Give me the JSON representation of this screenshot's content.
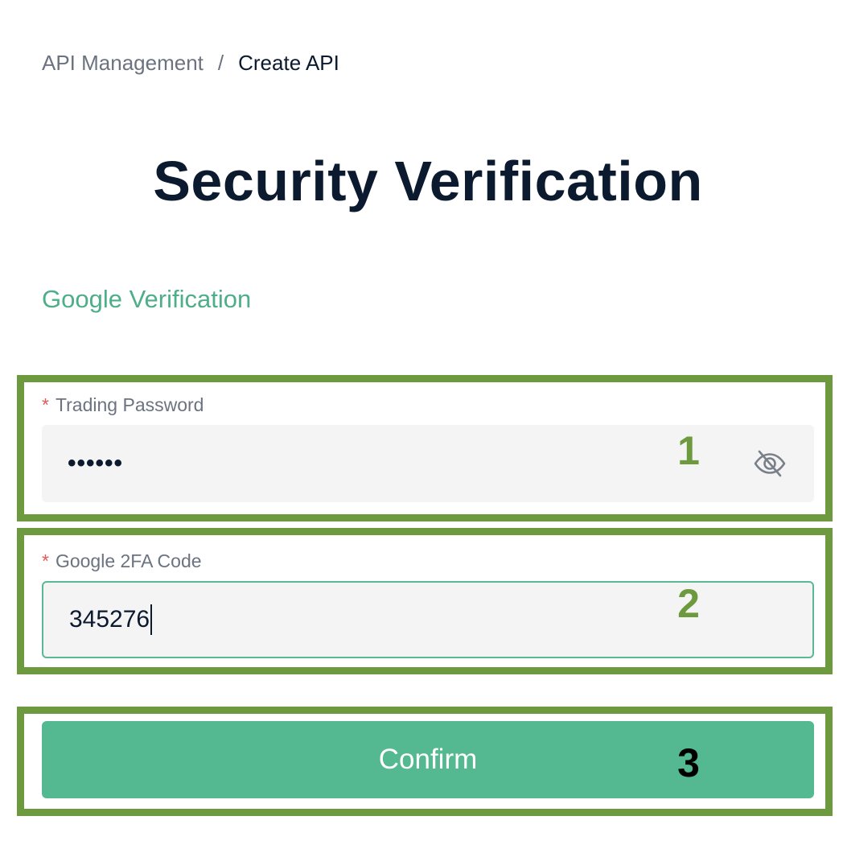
{
  "breadcrumb": {
    "parent": "API Management",
    "separator": "/",
    "current": "Create API"
  },
  "page": {
    "title": "Security Verification"
  },
  "section": {
    "label": "Google Verification"
  },
  "form": {
    "trading_password": {
      "required_mark": "*",
      "label": "Trading Password",
      "value": "••••••",
      "toggle_icon": "eye-slash-icon"
    },
    "google_2fa": {
      "required_mark": "*",
      "label": "Google 2FA Code",
      "value": "345276"
    },
    "confirm_label": "Confirm"
  },
  "annotations": {
    "step1": "1",
    "step2": "2",
    "step3": "3"
  },
  "colors": {
    "accent": "#54b990",
    "section_label": "#4fae8a",
    "highlight_border": "#6d9a3e",
    "required": "#e05a5a",
    "title": "#0b1a2e",
    "muted": "#6b7380",
    "input_bg": "#f4f4f4"
  }
}
